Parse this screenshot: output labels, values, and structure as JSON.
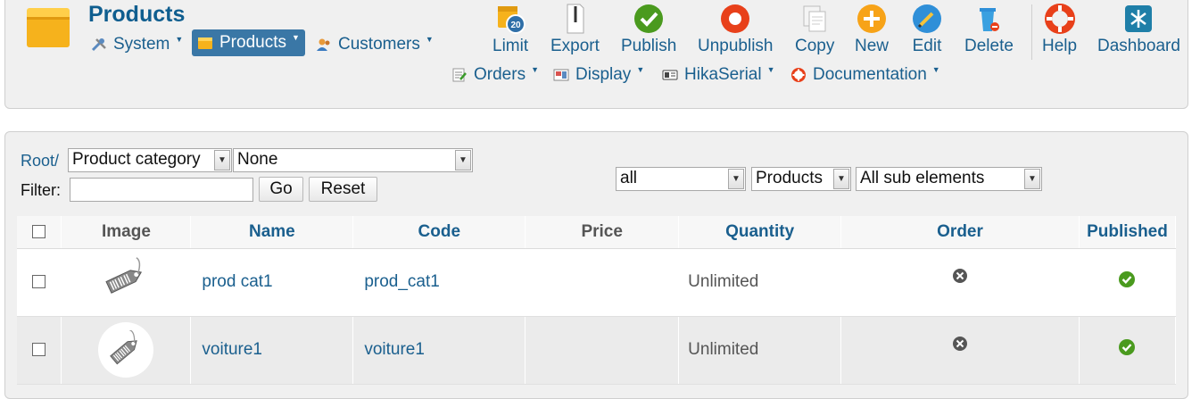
{
  "header": {
    "title": "Products",
    "menus_row1": [
      {
        "label": "System",
        "icon": "tools-icon"
      },
      {
        "label": "Products",
        "icon": "box-icon",
        "active": true
      },
      {
        "label": "Customers",
        "icon": "users-icon"
      }
    ],
    "menus_row2": [
      {
        "label": "Orders",
        "icon": "orders-icon"
      },
      {
        "label": "Display",
        "icon": "display-icon"
      },
      {
        "label": "HikaSerial",
        "icon": "serial-icon"
      },
      {
        "label": "Documentation",
        "icon": "lifebuoy-icon"
      }
    ],
    "toolbar": {
      "limit": "Limit",
      "limit_badge": "20",
      "export": "Export",
      "publish": "Publish",
      "unpublish": "Unpublish",
      "copy": "Copy",
      "new": "New",
      "edit": "Edit",
      "delete": "Delete",
      "help": "Help",
      "dashboard": "Dashboard"
    }
  },
  "filters": {
    "root_label": "Root/",
    "category_type": "Product category",
    "category_value": "None",
    "filter_label": "Filter:",
    "filter_value": "",
    "go_label": "Go",
    "reset_label": "Reset",
    "published_filter": "all",
    "element_type": "Products",
    "sub_elements": "All sub elements"
  },
  "table": {
    "headers": {
      "image": "Image",
      "name": "Name",
      "code": "Code",
      "price": "Price",
      "quantity": "Quantity",
      "order": "Order",
      "published": "Published"
    },
    "rows": [
      {
        "name": "prod cat1",
        "code": "prod_cat1",
        "price": "",
        "quantity": "Unlimited",
        "order_status": "unpublished",
        "published": true
      },
      {
        "name": "voiture1",
        "code": "voiture1",
        "price": "",
        "quantity": "Unlimited",
        "order_status": "unpublished",
        "published": true
      }
    ]
  },
  "colors": {
    "link": "#1a5f8e",
    "title": "#0f5e8f",
    "active_menu": "#3a77a6",
    "publish_green": "#4a9a1e",
    "unpublish_red": "#e8401a"
  }
}
